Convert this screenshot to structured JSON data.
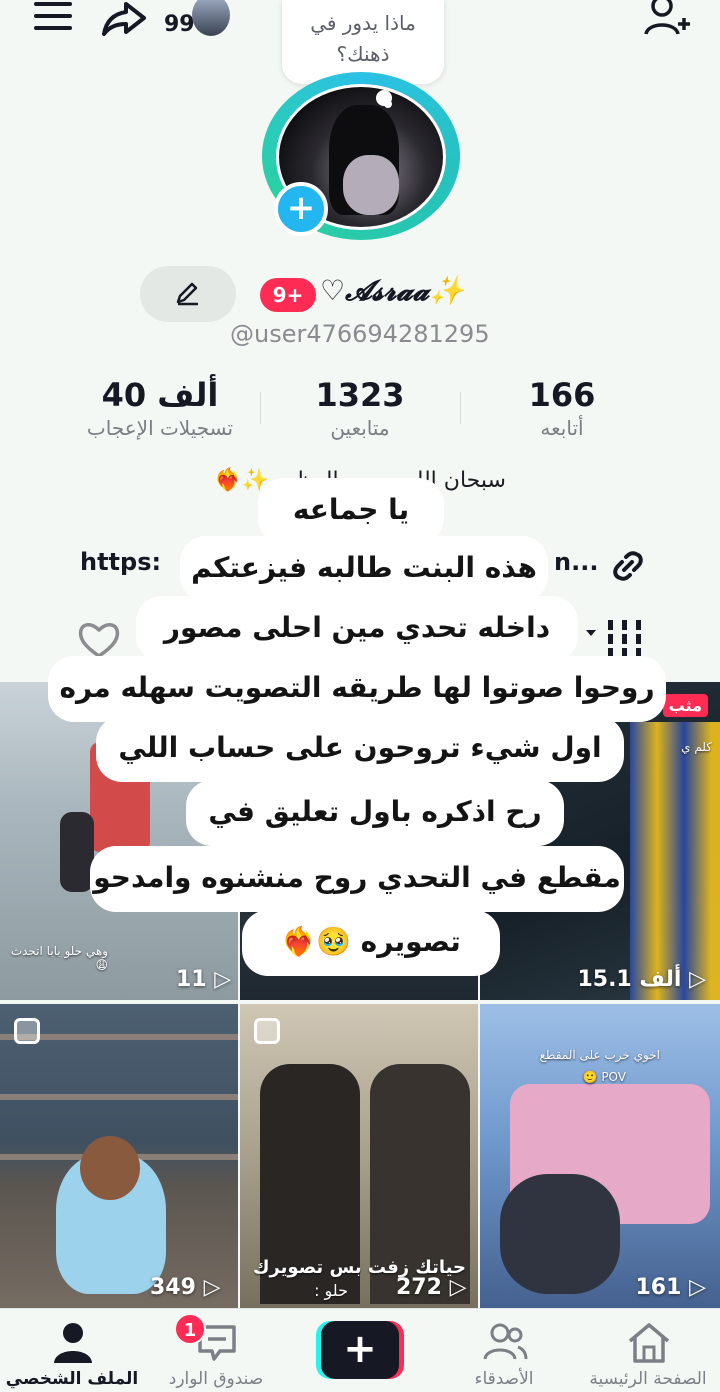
{
  "topbar": {
    "profile_views": "99"
  },
  "bubble": {
    "line1": "ماذا يدور في",
    "line2": "ذهنك؟"
  },
  "profile": {
    "notification_badge": "9+",
    "display_name": "♡𝓐𝓼𝓻𝓪𝓪✨",
    "username": "@user476694281295",
    "bio": "سبحان الله وب... العظيم ✨❤️‍🔥",
    "link_start": "https: ",
    "link_end": "n..."
  },
  "stats": [
    {
      "value": "166",
      "label": "أتابعه"
    },
    {
      "value": "1323",
      "label": "متابعين"
    },
    {
      "value": "40 ألف",
      "label": "تسجيلات الإعجاب"
    }
  ],
  "videos": [
    {
      "views": "11",
      "caption": "وهي حلو بابا اتحدث 😩"
    },
    {
      "views": "",
      "caption": ""
    },
    {
      "views": "15.1 ألف",
      "caption": "كلم ي",
      "badge": "مثب"
    },
    {
      "views": "349",
      "caption": ""
    },
    {
      "views": "272",
      "caption": "حياتك زفت بس تصويرك",
      "caption2": "حلو :"
    },
    {
      "views": "161",
      "caption": "اخوي خرب على المقطع",
      "caption2": "POV 🙂"
    }
  ],
  "overlay": {
    "lines": [
      "يا جماعه",
      "هذه البنت طالبه فيزعتكم",
      "داخله تحدي مين احلى مصور",
      "روحوا صوتوا لها طريقه التصويت سهله مره",
      "اول شيء تروحون على حساب اللي",
      "رح اذكره باول تعليق في",
      "مقطع في التحدي روح منشنوه وامدحو",
      "تصويره 🥹❤️‍🔥"
    ]
  },
  "nav": {
    "home": "الصفحة الرئيسية",
    "friends": "الأصدقاء",
    "create": "+",
    "inbox": "صندوق الوارد",
    "inbox_badge": "1",
    "profile": "الملف الشخصي"
  },
  "colors": {
    "accent_red": "#fe2c55",
    "accent_cyan": "#25f4ee",
    "avatar_plus": "#23b6f0"
  }
}
